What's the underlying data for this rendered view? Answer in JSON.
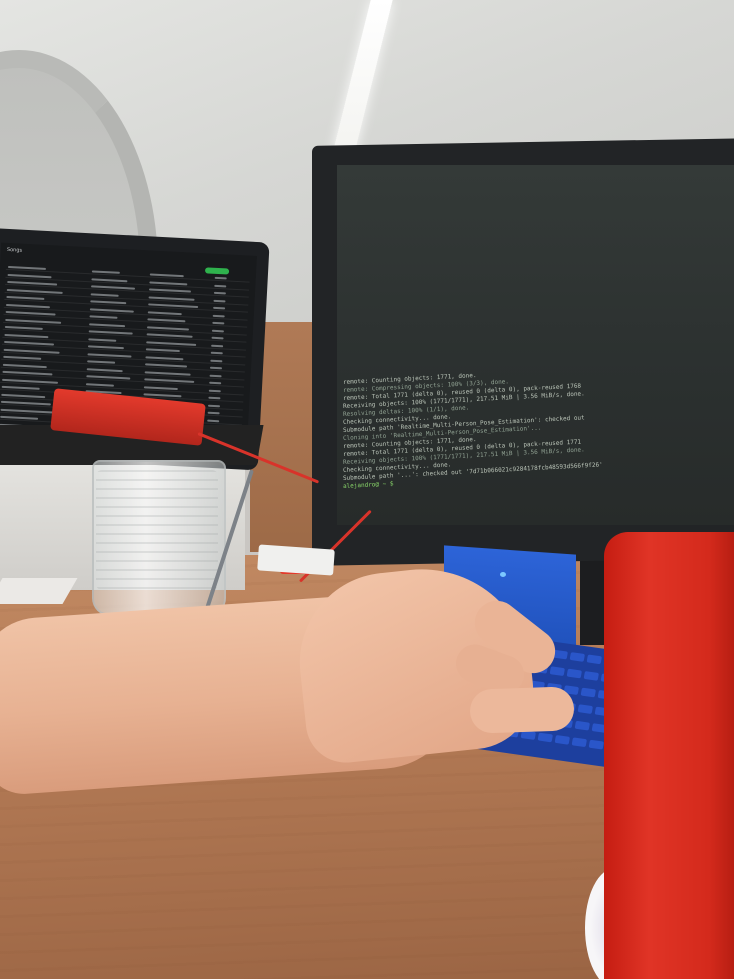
{
  "scene": {
    "description_label": "",
    "laptop_screen": {
      "title": "Songs",
      "playlist_rows": 22
    },
    "terminal": {
      "lines": [
        "remote: Counting objects: 1771, done.",
        "remote: Compressing objects: 100% (3/3), done.",
        "remote: Total 1771 (delta 0), reused 0 (delta 0), pack-reused 1768",
        "Receiving objects: 100% (1771/1771), 217.51 MiB | 3.56 MiB/s, done.",
        "Resolving deltas: 100% (1/1), done.",
        "Checking connectivity... done.",
        "Submodule path 'Realtime_Multi-Person_Pose_Estimation': checked out",
        "Cloning into 'Realtime_Multi-Person_Pose_Estimation'...",
        "remote: Counting objects: 1771, done.",
        "remote: Total 1771 (delta 0), reused 0 (delta 0), pack-reused 1771",
        "Receiving objects: 100% (1771/1771), 217.51 MiB | 3.56 MiB/s, done.",
        "Checking connectivity... done.",
        "Submodule path '...': checked out '7d71b066021c9284178fcb48593d566f9f26'"
      ],
      "prompt": "alejandro@ ~ $",
      "colors": {
        "text": "#b9c3b7",
        "prompt": "#88d56a",
        "background": "#2f3433"
      }
    },
    "colors": {
      "mug": "#d42a1c",
      "keyboard": "#1e4fb8",
      "battery": "#e33a2c",
      "desk": "#b37a55"
    }
  }
}
